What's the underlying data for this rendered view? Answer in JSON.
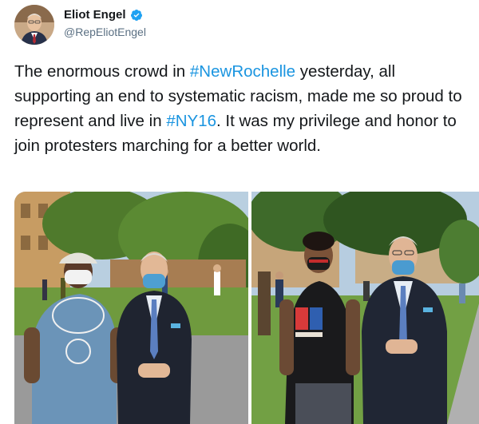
{
  "author": {
    "name": "Eliot Engel",
    "handle": "@RepEliotEngel",
    "verified": true
  },
  "tweet": {
    "segments": [
      {
        "text": "The enormous crowd in ",
        "type": "text"
      },
      {
        "text": "#NewRochelle",
        "type": "hashtag"
      },
      {
        "text": " yesterday, all supporting an end to systematic racism, made me so proud to represent and live in ",
        "type": "text"
      },
      {
        "text": "#NY16",
        "type": "hashtag"
      },
      {
        "text": ". It was my privilege and honor to join protesters marching for a better world.",
        "type": "text"
      }
    ]
  },
  "media": {
    "photos": [
      {
        "name": "photo-left",
        "subject": "two men in masks posing outdoors, one in blue t-shirt and white cap, one in dark suit"
      },
      {
        "name": "photo-right",
        "subject": "young man in black t-shirt and red mask beside man in dark suit and blue mask on grass"
      }
    ],
    "shirt_print_colors": [
      "#d83a3a",
      "#2f5fb0"
    ]
  },
  "colors": {
    "hashtag": "#1b95e0",
    "verified_badge": "#1da1f2",
    "text": "#14171a",
    "secondary_text": "#5b7083"
  }
}
